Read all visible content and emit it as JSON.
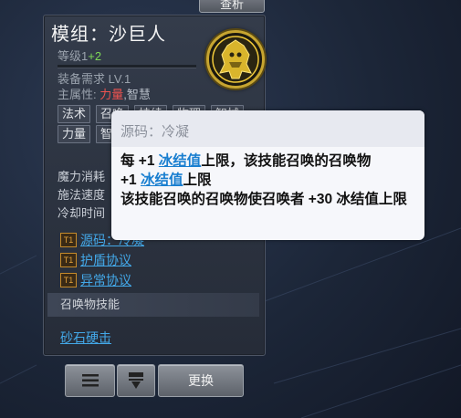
{
  "top_tab": {
    "label": "查析"
  },
  "module": {
    "title": "模组：沙巨人",
    "level_prefix": "等级",
    "level_base": "1",
    "level_bonus": "+2",
    "requirement": "装备需求 LV.1",
    "attr_prefix": "主属性: ",
    "attr_primary": "力量",
    "attr_sep": ",",
    "attr_secondary": "智慧",
    "emblem_icon": "sand-golem-icon",
    "tags_row1": [
      "法术",
      "召唤",
      "持续",
      "物理",
      "智械"
    ],
    "tags_row2": [
      "力量",
      "智慧"
    ],
    "stats": [
      "魔力消耗",
      "施法速度",
      "冷却时间"
    ],
    "links": [
      "源码：冷凝",
      "护盾协议",
      "异常协议"
    ],
    "section_label": "召唤物技能",
    "skill_link": "砂石硬击"
  },
  "buttons": {
    "menu_icon": "menu-icon",
    "swap_icon": "download-swap-icon",
    "replace_label": "更换"
  },
  "tooltip": {
    "source": "源码：冷凝",
    "line1_a": "每 +1 ",
    "line1_kw": "冰结值",
    "line1_b": "上限，该技能召唤的召唤物",
    "line2_a": "+1 ",
    "line2_kw": "冰结值",
    "line2_b": "上限",
    "line3": "该技能召唤的召唤物使召唤者 +30 冰结值上限"
  },
  "colors": {
    "link": "#43a8e8",
    "primary_attr": "#ef5350",
    "level_bonus": "#7ed957",
    "keyword": "#1a7fd0"
  }
}
